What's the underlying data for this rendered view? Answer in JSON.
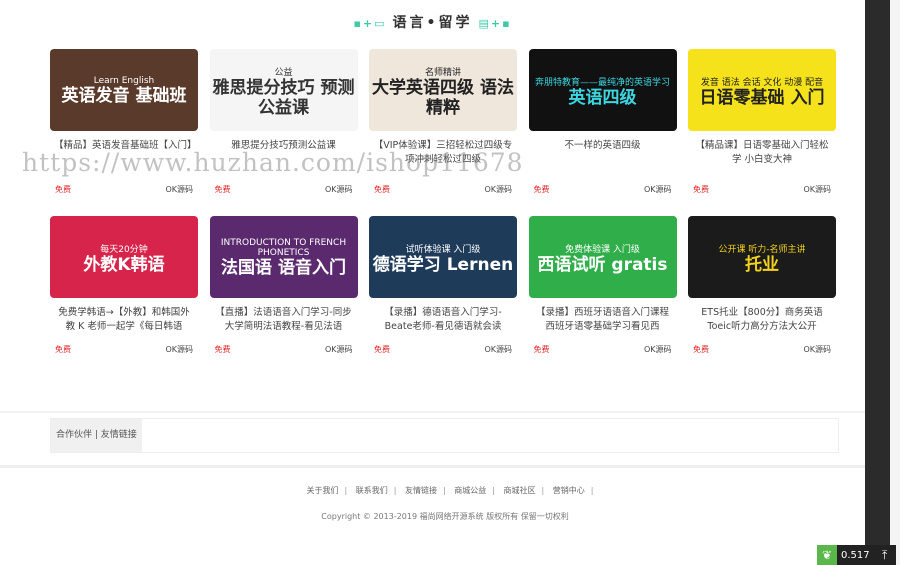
{
  "section_title": "语言•留学",
  "watermark": "https://www.huzhan.com/ishop11678",
  "courses_row1": [
    {
      "thumb_text": "英语发音 基础班",
      "thumb_sub": "Learn English",
      "bg": "#5a3a2a",
      "fg": "#fff",
      "title": "【精品】英语发音基础班【入门】",
      "price": "免费",
      "source": "OK源码"
    },
    {
      "thumb_text": "雅思提分技巧 预测公益课",
      "thumb_sub": "公益",
      "bg": "#f5f5f5",
      "fg": "#333",
      "title": "雅思提分技巧预测公益课",
      "price": "免费",
      "source": "OK源码"
    },
    {
      "thumb_text": "大学英语四级 语法精粹",
      "thumb_sub": "名师精讲",
      "bg": "#efe6dc",
      "fg": "#222",
      "title": "【VIP体验课】三招轻松过四级专项冲刺轻松过四级",
      "price": "免费",
      "source": "OK源码"
    },
    {
      "thumb_text": "英语四级",
      "thumb_sub": "奔朋特教育——最纯净的英语学习",
      "bg": "#111",
      "fg": "#3dd6e0",
      "title": "不一样的英语四级",
      "price": "免费",
      "source": "OK源码"
    },
    {
      "thumb_text": "日语零基础 入门",
      "thumb_sub": "发音 语法 会话 文化 动漫 配音",
      "bg": "#f5e21a",
      "fg": "#222",
      "title": "【精品课】日语零基础入门轻松学 小白变大神",
      "price": "免费",
      "source": "OK源码"
    }
  ],
  "courses_row2": [
    {
      "thumb_text": "外教K韩语",
      "thumb_sub": "每天20分钟",
      "bg": "#d6244a",
      "fg": "#fff",
      "title": "免费学韩语→【外教】和韩国外教 K 老师一起学《每日韩语",
      "price": "免费",
      "source": "OK源码"
    },
    {
      "thumb_text": "法国语 语音入门",
      "thumb_sub": "INTRODUCTION TO FRENCH PHONETICS",
      "bg": "#5b2a6e",
      "fg": "#fff",
      "title": "【直播】法语语音入门学习-同步大学简明法语教程-看见法语",
      "price": "免费",
      "source": "OK源码"
    },
    {
      "thumb_text": "德语学习 Lernen",
      "thumb_sub": "试听体验课 入门级",
      "bg": "#1f3b5a",
      "fg": "#fff",
      "title": "【录播】德语语音入门学习-Beate老师-看见德语就会读",
      "price": "免费",
      "source": "OK源码"
    },
    {
      "thumb_text": "西语试听 gratis",
      "thumb_sub": "免费体验课 入门级",
      "bg": "#2fae4a",
      "fg": "#fff",
      "title": "【录播】西班牙语语音入门课程西班牙语零基础学习看见西",
      "price": "免费",
      "source": "OK源码"
    },
    {
      "thumb_text": "托业",
      "thumb_sub": "公开课 听力-名师主讲",
      "bg": "#1b1b1b",
      "fg": "#f5d21a",
      "title": "ETS托业【800分】商务英语Toeic听力高分方法大公开",
      "price": "免费",
      "source": "OK源码"
    }
  ],
  "partner_label": "合作伙伴 | 友情链接",
  "footer_links": [
    "关于我们",
    "联系我们",
    "友情链接",
    "商城公益",
    "商城社区",
    "营销中心"
  ],
  "copyright": "Copyright © 2013-2019 福尚网络开源系统 版权所有 保留一切权利",
  "fps_value": "0.517",
  "back_to_top": "⤒"
}
